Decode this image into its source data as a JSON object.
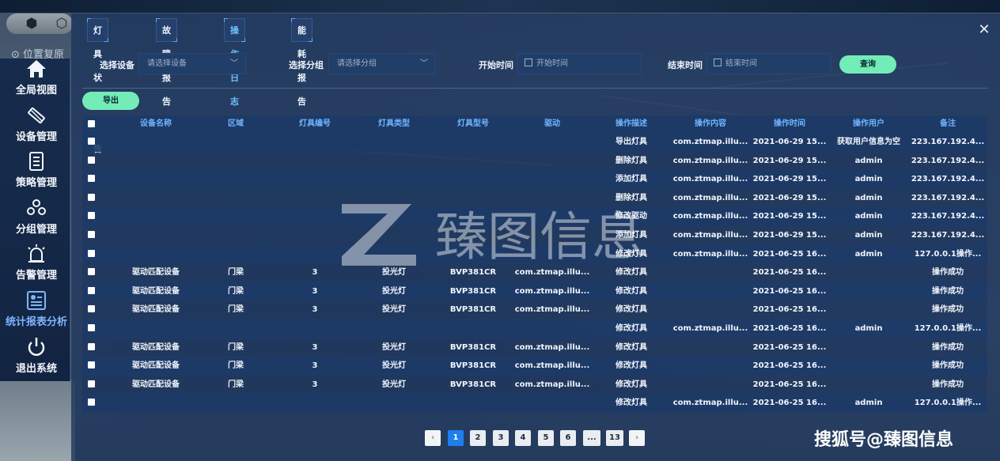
{
  "scene": {
    "locate_label": "位置复原",
    "cube_icons": [
      "cube-icon",
      "cube-outline-icon"
    ]
  },
  "nav": {
    "items": [
      {
        "label": "全局视图",
        "icon": "home-icon",
        "active": false
      },
      {
        "label": "设备管理",
        "icon": "lamp-icon",
        "active": false
      },
      {
        "label": "策略管理",
        "icon": "document-icon",
        "active": false
      },
      {
        "label": "分组管理",
        "icon": "group-icon",
        "active": false
      },
      {
        "label": "告警管理",
        "icon": "alarm-icon",
        "active": false
      },
      {
        "label": "统计报表分析",
        "icon": "report-icon",
        "active": true
      },
      {
        "label": "退出系统",
        "icon": "power-icon",
        "active": false
      }
    ]
  },
  "tabs": [
    {
      "label": "灯具状态报告",
      "active": false
    },
    {
      "label": "故障报告",
      "active": false
    },
    {
      "label": "操作日志",
      "active": true
    },
    {
      "label": "能耗报告",
      "active": false
    }
  ],
  "close_icon": "close-icon",
  "filters": {
    "device_label": "选择设备",
    "device_placeholder": "请选择设备",
    "group_label": "选择分组",
    "group_placeholder": "请选择分组",
    "start_label": "开始时间",
    "start_placeholder": "开始时间",
    "end_label": "结束时间",
    "end_placeholder": "结束时间",
    "query_label": "查询"
  },
  "export_label": "导出",
  "table": {
    "headers": [
      "设备名称",
      "区域",
      "灯具编号",
      "灯具类型",
      "灯具型号",
      "驱动",
      "操作描述",
      "操作内容",
      "操作时间",
      "操作用户",
      "备注"
    ],
    "rows": [
      [
        "",
        "",
        "",
        "",
        "",
        "",
        "导出灯具",
        "com.ztmap.illu...",
        "2021-06-29 15...",
        "获取用户信息为空",
        "223.167.192.4..."
      ],
      [
        "",
        "",
        "",
        "",
        "",
        "",
        "删除灯具",
        "com.ztmap.illu...",
        "2021-06-29 15...",
        "admin",
        "223.167.192.4..."
      ],
      [
        "",
        "",
        "",
        "",
        "",
        "",
        "添加灯具",
        "com.ztmap.illu...",
        "2021-06-29 15...",
        "admin",
        "223.167.192.4..."
      ],
      [
        "",
        "",
        "",
        "",
        "",
        "",
        "删除灯具",
        "com.ztmap.illu...",
        "2021-06-29 15...",
        "admin",
        "223.167.192.4..."
      ],
      [
        "",
        "",
        "",
        "",
        "",
        "",
        "修改驱动",
        "com.ztmap.illu...",
        "2021-06-29 15...",
        "admin",
        "223.167.192.4..."
      ],
      [
        "",
        "",
        "",
        "",
        "",
        "",
        "添加灯具",
        "com.ztmap.illu...",
        "2021-06-29 15...",
        "admin",
        "223.167.192.4..."
      ],
      [
        "",
        "",
        "",
        "",
        "",
        "",
        "修改灯具",
        "com.ztmap.illu...",
        "2021-06-25 16...",
        "admin",
        "127.0.0.1操作..."
      ],
      [
        "驱动匹配设备",
        "门梁",
        "3",
        "投光灯",
        "BVP381CR",
        "com.ztmap.illu...",
        "修改灯具",
        "",
        "2021-06-25 16...",
        "",
        "操作成功"
      ],
      [
        "驱动匹配设备",
        "门梁",
        "3",
        "投光灯",
        "BVP381CR",
        "com.ztmap.illu...",
        "修改灯具",
        "",
        "2021-06-25 16...",
        "",
        "操作成功"
      ],
      [
        "驱动匹配设备",
        "门梁",
        "3",
        "投光灯",
        "BVP381CR",
        "com.ztmap.illu...",
        "修改灯具",
        "",
        "2021-06-25 16...",
        "",
        "操作成功"
      ],
      [
        "",
        "",
        "",
        "",
        "",
        "",
        "修改灯具",
        "com.ztmap.illu...",
        "2021-06-25 16...",
        "admin",
        "127.0.0.1操作..."
      ],
      [
        "驱动匹配设备",
        "门梁",
        "3",
        "投光灯",
        "BVP381CR",
        "com.ztmap.illu...",
        "修改灯具",
        "",
        "2021-06-25 16...",
        "",
        "操作成功"
      ],
      [
        "驱动匹配设备",
        "门梁",
        "3",
        "投光灯",
        "BVP381CR",
        "com.ztmap.illu...",
        "修改灯具",
        "",
        "2021-06-25 16...",
        "",
        "操作成功"
      ],
      [
        "驱动匹配设备",
        "门梁",
        "3",
        "投光灯",
        "BVP381CR",
        "com.ztmap.illu...",
        "修改灯具",
        "",
        "2021-06-25 16...",
        "",
        "操作成功"
      ],
      [
        "",
        "",
        "",
        "",
        "",
        "",
        "修改灯具",
        "com.ztmap.illu...",
        "2021-06-25 16...",
        "admin",
        "127.0.0.1操作..."
      ]
    ]
  },
  "pagination": {
    "prev_icon": "chevron-left-icon",
    "pages": [
      "1",
      "2",
      "3",
      "4",
      "5",
      "6",
      "...",
      "13"
    ],
    "current": "1",
    "next_icon": "chevron-right-icon"
  },
  "watermark": {
    "logo_text": "臻图信息",
    "corner_text": "搜狐号@臻图信息"
  },
  "colors": {
    "accent_green": "#73ecb8",
    "active_blue": "#1e7ef0",
    "header_text": "#6fb4ff"
  }
}
